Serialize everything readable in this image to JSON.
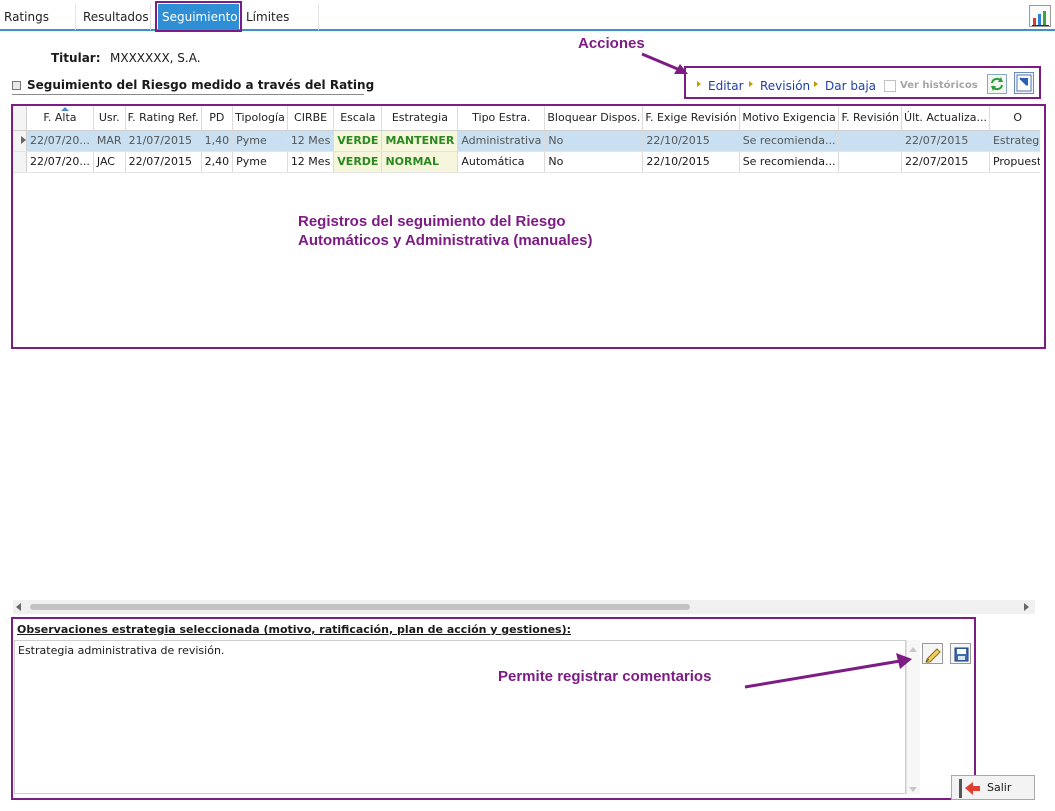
{
  "tabs": [
    "Ratings",
    "Resultados",
    "Seguimiento",
    "Límites"
  ],
  "active_tab": "Seguimiento",
  "header": {
    "titular_label": "Titular:",
    "titular_value": "MXXXXXX, S.A.",
    "section_title": "Seguimiento del Riesgo medido a través del Rating"
  },
  "actions": {
    "callout": "Acciones",
    "editar": "Editar",
    "revision": "Revisión",
    "dar_baja": "Dar baja",
    "ver_historicos": "Ver históricos",
    "ver_historicos_checked": false
  },
  "grid": {
    "columns": [
      "F. Alta",
      "Usr.",
      "F. Rating Ref.",
      "PD",
      "Tipología",
      "CIRBE",
      "Escala",
      "Estrategia",
      "Tipo Estra.",
      "Bloquear Dispos.",
      "F. Exige Revisión",
      "Motivo Exigencia",
      "F. Revisión",
      "Últ. Actualiza...",
      "O"
    ],
    "rows": [
      [
        "22/07/20...",
        "MAR",
        "21/07/2015",
        "1,40",
        "Pyme",
        "12 Mes",
        "VERDE",
        "MANTENER",
        "Administrativa",
        "No",
        "22/10/2015",
        "Se recomienda...",
        "",
        "22/07/2015",
        "Estrategi"
      ],
      [
        "22/07/20...",
        "JAC",
        "22/07/2015",
        "2,40",
        "Pyme",
        "12 Mes",
        "VERDE",
        "NORMAL",
        "Automática",
        "No",
        "22/10/2015",
        "Se recomienda...",
        "",
        "22/07/2015",
        "Propuest"
      ]
    ],
    "selected_row": 0,
    "callout_line1": "Registros del seguimiento del Riesgo",
    "callout_line2": "Automáticos y Administrativa (manuales)"
  },
  "observations": {
    "label": "Observaciones estrategia seleccionada (motivo, ratificación, plan de acción y gestiones):",
    "text": "Estrategia administrativa de revisión.",
    "callout": "Permite registrar comentarios"
  },
  "footer": {
    "salir": "Salir"
  },
  "colors": {
    "annotation": "#7d1c84",
    "tab_active": "#2e8fd5",
    "selected_row": "#c8e0f2",
    "scale_green": "#2b8a1f",
    "link": "#1f3fa8"
  },
  "icons": [
    "chart-icon",
    "refresh-icon",
    "export-icon",
    "edit-comment-icon",
    "save-icon",
    "exit-icon"
  ]
}
